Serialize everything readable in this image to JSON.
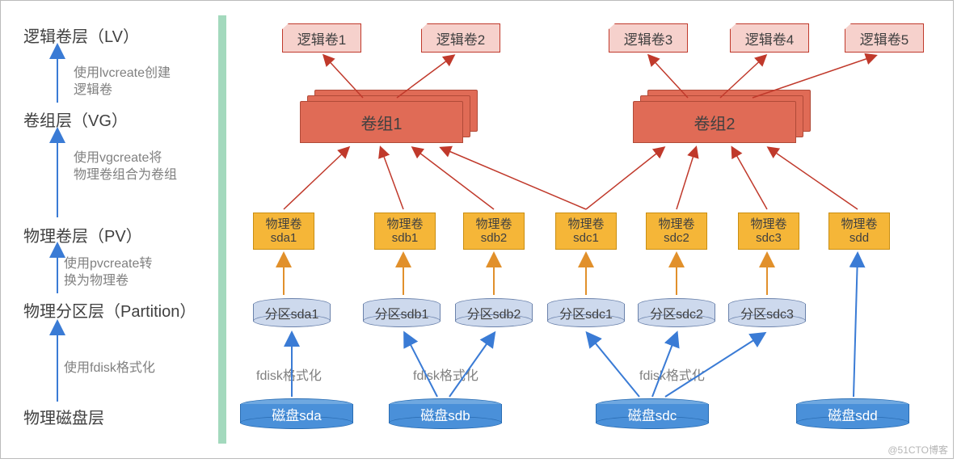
{
  "layers": {
    "lv": {
      "title": "逻辑卷层（LV）",
      "note": "使用lvcreate创建\n逻辑卷"
    },
    "vg": {
      "title": "卷组层（VG）",
      "note": "使用vgcreate将\n物理卷组合为卷组"
    },
    "pv": {
      "title": "物理卷层（PV）",
      "note": "使用pvcreate转\n换为物理卷"
    },
    "partition": {
      "title": "物理分区层（Partition）",
      "note": "使用fdisk格式化"
    },
    "disk": {
      "title": "物理磁盘层"
    }
  },
  "lv_items": [
    "逻辑卷1",
    "逻辑卷2",
    "逻辑卷3",
    "逻辑卷4",
    "逻辑卷5"
  ],
  "vg_items": [
    "卷组1",
    "卷组2"
  ],
  "pv_items": [
    {
      "label_top": "物理卷",
      "label_bottom": "sda1"
    },
    {
      "label_top": "物理卷",
      "label_bottom": "sdb1"
    },
    {
      "label_top": "物理卷",
      "label_bottom": "sdb2"
    },
    {
      "label_top": "物理卷",
      "label_bottom": "sdc1"
    },
    {
      "label_top": "物理卷",
      "label_bottom": "sdc2"
    },
    {
      "label_top": "物理卷",
      "label_bottom": "sdc3"
    },
    {
      "label_top": "物理卷",
      "label_bottom": "sdd"
    }
  ],
  "partitions": [
    "分区sda1",
    "分区sdb1",
    "分区sdb2",
    "分区sdc1",
    "分区sdc2",
    "分区sdc3"
  ],
  "disks": [
    "磁盘sda",
    "磁盘sdb",
    "磁盘sdc",
    "磁盘sdd"
  ],
  "fdisk_notes": [
    "fdisk格式化",
    "fdisk格式化",
    "fdisk格式化"
  ],
  "watermark": "@51CTO博客",
  "chart_data": {
    "type": "hierarchy",
    "title": "LVM layer diagram",
    "nodes": {
      "disks": [
        "sda",
        "sdb",
        "sdc",
        "sdd"
      ],
      "partitions": [
        "sda1",
        "sdb1",
        "sdb2",
        "sdc1",
        "sdc2",
        "sdc3"
      ],
      "pvs": [
        "sda1",
        "sdb1",
        "sdb2",
        "sdc1",
        "sdc2",
        "sdc3",
        "sdd"
      ],
      "vgs": [
        "卷组1",
        "卷组2"
      ],
      "lvs": [
        "逻辑卷1",
        "逻辑卷2",
        "逻辑卷3",
        "逻辑卷4",
        "逻辑卷5"
      ]
    },
    "edges": {
      "disk_to_partition": {
        "sda": [
          "sda1"
        ],
        "sdb": [
          "sdb1",
          "sdb2"
        ],
        "sdc": [
          "sdc1",
          "sdc2",
          "sdc3"
        ],
        "sdd": []
      },
      "partition_to_pv": {
        "sda1": "sda1",
        "sdb1": "sdb1",
        "sdb2": "sdb2",
        "sdc1": "sdc1",
        "sdc2": "sdc2",
        "sdc3": "sdc3"
      },
      "disk_to_pv_direct": {
        "sdd": "sdd"
      },
      "pv_to_vg": {
        "sda1": "卷组1",
        "sdb1": "卷组1",
        "sdb2": "卷组1",
        "sdc1": "卷组1",
        "sdc2": "卷组2",
        "sdc3": "卷组2",
        "sdd": "卷组2"
      },
      "pv_to_vg_cross": {
        "sdc1": "卷组2"
      },
      "vg_to_lv": {
        "卷组1": [
          "逻辑卷1",
          "逻辑卷2"
        ],
        "卷组2": [
          "逻辑卷3",
          "逻辑卷4",
          "逻辑卷5"
        ]
      }
    }
  }
}
